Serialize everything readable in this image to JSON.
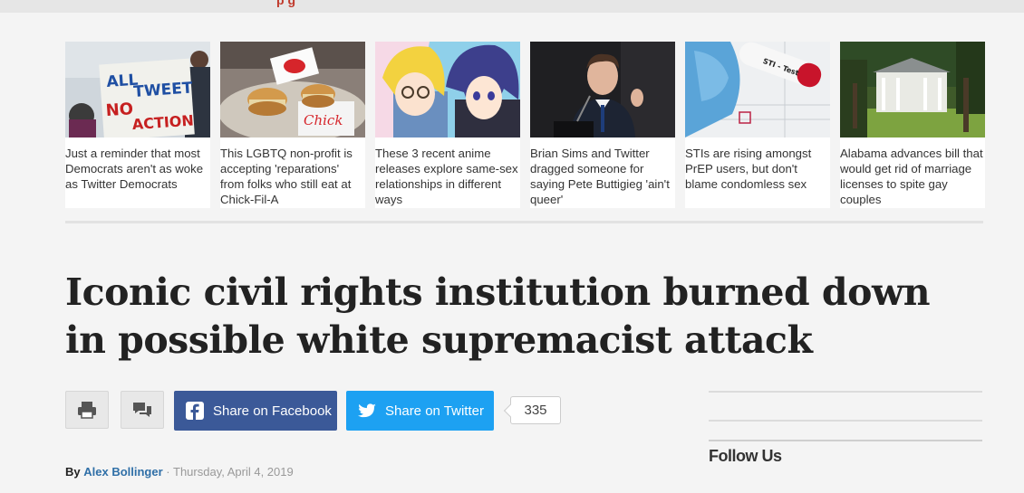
{
  "top_nav": {
    "partial_red_text": "p           g"
  },
  "related_stories": [
    {
      "caption": "Just a reminder that most Democrats aren't as woke as Twitter Democrats",
      "image": "protest-sign-photo",
      "sign_text": [
        "ALL",
        "TWEET",
        "NO",
        "ACTION"
      ]
    },
    {
      "caption": "This LGBTQ non-profit is accepting 'reparations' from folks who still eat at Chick-Fil-A",
      "image": "chick-fil-a-sandwiches-photo",
      "wrapper_text": "Chick"
    },
    {
      "caption": "These 3 recent anime releases explore same-sex relationships in different ways",
      "image": "anime-characters-illustration"
    },
    {
      "caption": "Brian Sims and Twitter dragged someone for saying Pete Buttigieg 'ain't queer'",
      "image": "speaker-at-podium-photo"
    },
    {
      "caption": "STIs are rising amongst PrEP users, but don't blame condomless sex",
      "image": "sti-test-tube-photo",
      "tube_label": "STI - Test"
    },
    {
      "caption": "Alabama advances bill that would get rid of marriage licenses to spite gay couples",
      "image": "southern-mansion-photo"
    }
  ],
  "article": {
    "headline": "Iconic civil rights institution burned down in possible white supremacist attack",
    "byline_prefix": "By",
    "author": "Alex Bollinger",
    "separator": " · ",
    "date": "Thursday, April 4, 2019"
  },
  "share_bar": {
    "print_icon": "printer-icon",
    "comments_icon": "comments-icon",
    "facebook_label": "Share on Facebook",
    "twitter_label": "Share on Twitter",
    "share_count": "335"
  },
  "sidebar": {
    "follow_title": "Follow Us"
  },
  "colors": {
    "facebook": "#3b5998",
    "twitter": "#1da1f2",
    "author_link": "#2f6fa7"
  }
}
